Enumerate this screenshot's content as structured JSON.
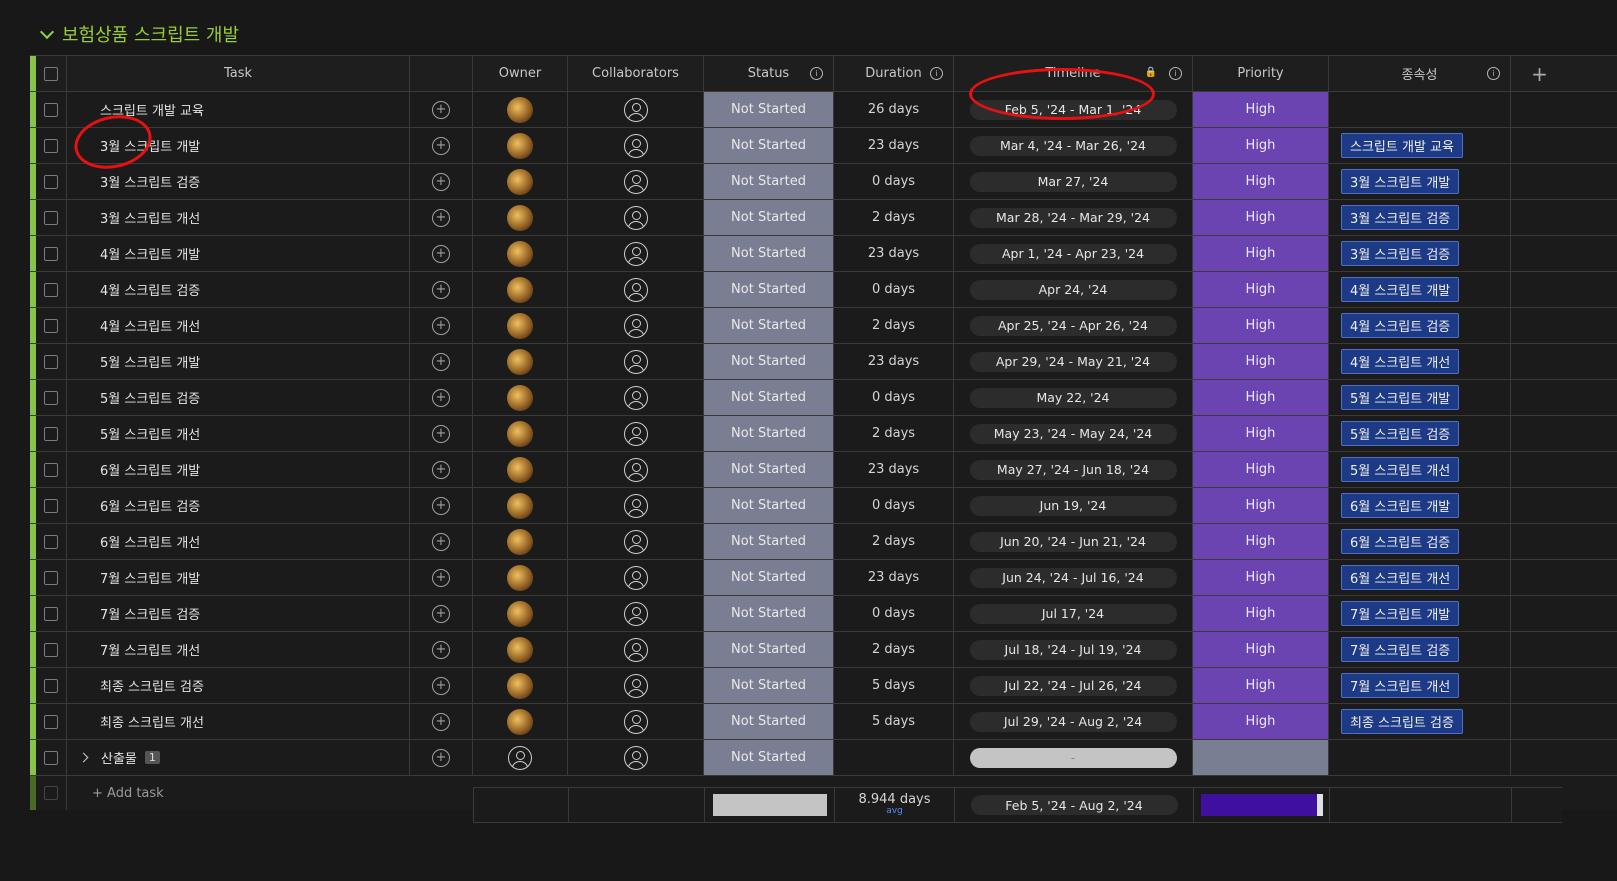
{
  "group": {
    "title": "보험상품 스크립트 개발"
  },
  "columns": {
    "task": "Task",
    "owner": "Owner",
    "collaborators": "Collaborators",
    "status": "Status",
    "duration": "Duration",
    "timeline": "Timeline",
    "priority": "Priority",
    "dependency": "종속성"
  },
  "rows": [
    {
      "task": "스크립트 개발 교육",
      "status": "Not Started",
      "duration": "26 days",
      "timeline": "Feb 5, '24 - Mar 1, '24",
      "priority": "High",
      "dependency": ""
    },
    {
      "task": "3월 스크립트 개발",
      "status": "Not Started",
      "duration": "23 days",
      "timeline": "Mar 4, '24 - Mar 26, '24",
      "priority": "High",
      "dependency": "스크립트 개발 교육"
    },
    {
      "task": "3월 스크립트 검증",
      "status": "Not Started",
      "duration": "0 days",
      "timeline": "Mar 27, '24",
      "priority": "High",
      "dependency": "3월 스크립트 개발"
    },
    {
      "task": "3월 스크립트 개선",
      "status": "Not Started",
      "duration": "2 days",
      "timeline": "Mar 28, '24 - Mar 29, '24",
      "priority": "High",
      "dependency": "3월 스크립트 검증"
    },
    {
      "task": "4월 스크립트 개발",
      "status": "Not Started",
      "duration": "23 days",
      "timeline": "Apr 1, '24 - Apr 23, '24",
      "priority": "High",
      "dependency": "3월 스크립트 검증"
    },
    {
      "task": "4월 스크립트 검증",
      "status": "Not Started",
      "duration": "0 days",
      "timeline": "Apr 24, '24",
      "priority": "High",
      "dependency": "4월 스크립트 개발"
    },
    {
      "task": "4월 스크립트 개선",
      "status": "Not Started",
      "duration": "2 days",
      "timeline": "Apr 25, '24 - Apr 26, '24",
      "priority": "High",
      "dependency": "4월 스크립트 검증"
    },
    {
      "task": "5월 스크립트 개발",
      "status": "Not Started",
      "duration": "23 days",
      "timeline": "Apr 29, '24 - May 21, '24",
      "priority": "High",
      "dependency": "4월 스크립트 개선"
    },
    {
      "task": "5월 스크립트 검증",
      "status": "Not Started",
      "duration": "0 days",
      "timeline": "May 22, '24",
      "priority": "High",
      "dependency": "5월 스크립트 개발"
    },
    {
      "task": "5월 스크립트 개선",
      "status": "Not Started",
      "duration": "2 days",
      "timeline": "May 23, '24 - May 24, '24",
      "priority": "High",
      "dependency": "5월 스크립트 검증"
    },
    {
      "task": "6월 스크립트 개발",
      "status": "Not Started",
      "duration": "23 days",
      "timeline": "May 27, '24 - Jun 18, '24",
      "priority": "High",
      "dependency": "5월 스크립트 개선"
    },
    {
      "task": "6월 스크립트 검증",
      "status": "Not Started",
      "duration": "0 days",
      "timeline": "Jun 19, '24",
      "priority": "High",
      "dependency": "6월 스크립트 개발"
    },
    {
      "task": "6월 스크립트 개선",
      "status": "Not Started",
      "duration": "2 days",
      "timeline": "Jun 20, '24 - Jun 21, '24",
      "priority": "High",
      "dependency": "6월 스크립트 검증"
    },
    {
      "task": "7월 스크립트 개발",
      "status": "Not Started",
      "duration": "23 days",
      "timeline": "Jun 24, '24 - Jul 16, '24",
      "priority": "High",
      "dependency": "6월 스크립트 개선"
    },
    {
      "task": "7월 스크립트 검증",
      "status": "Not Started",
      "duration": "0 days",
      "timeline": "Jul 17, '24",
      "priority": "High",
      "dependency": "7월 스크립트 개발"
    },
    {
      "task": "7월 스크립트 개선",
      "status": "Not Started",
      "duration": "2 days",
      "timeline": "Jul 18, '24 - Jul 19, '24",
      "priority": "High",
      "dependency": "7월 스크립트 검증"
    },
    {
      "task": "최종 스크립트 검증",
      "status": "Not Started",
      "duration": "5 days",
      "timeline": "Jul 22, '24 - Jul 26, '24",
      "priority": "High",
      "dependency": "7월 스크립트 개선"
    },
    {
      "task": "최종 스크립트 개선",
      "status": "Not Started",
      "duration": "5 days",
      "timeline": "Jul 29, '24 - Aug 2, '24",
      "priority": "High",
      "dependency": "최종 스크립트 검증"
    }
  ],
  "subgroup_row": {
    "task": "산출물",
    "badge": "1",
    "status": "Not Started",
    "timeline": "-"
  },
  "add_task": "+ Add task",
  "summary": {
    "duration": "8.944 days",
    "duration_label": "avg",
    "timeline": "Feb 5, '24 - Aug 2, '24"
  },
  "icons": {
    "group_toggle": "chevron-down-icon",
    "info": "info-icon",
    "lock": "lock-icon",
    "add_column": "plus-icon",
    "add_update": "add-update-icon",
    "person": "person-icon",
    "expand": "chevron-right-icon"
  },
  "colors": {
    "group_accent": "#8bc34a",
    "status_not_started": "#797e93",
    "priority_high": "#6b44b2",
    "dependency_tag": "#1d3a86",
    "annotation": "#e81111"
  }
}
